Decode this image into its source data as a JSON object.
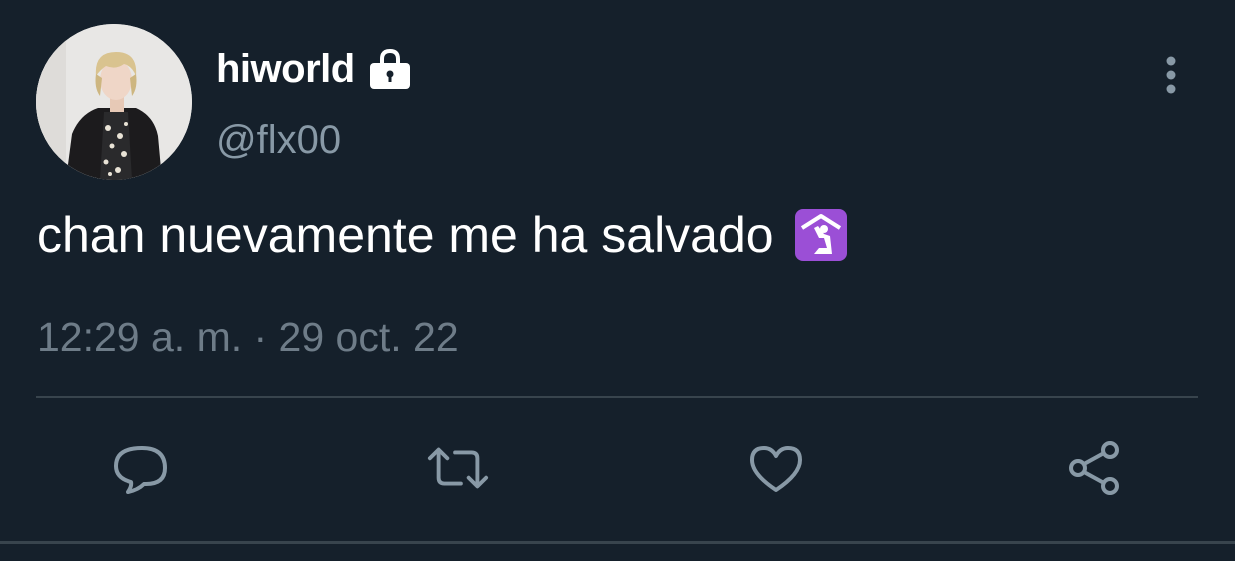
{
  "user": {
    "display_name": "hiworld",
    "handle": "@flx00",
    "protected_icon": "lock-icon",
    "avatar": "profile-photo"
  },
  "tweet": {
    "text": "chan nuevamente me ha salvado",
    "emoji": "place-of-worship-emoji",
    "timestamp": "12:29 a. m. · 29 oct. 22"
  },
  "actions": [
    {
      "name": "reply",
      "icon": "speech-bubble-icon"
    },
    {
      "name": "retweet",
      "icon": "retweet-icon"
    },
    {
      "name": "like",
      "icon": "heart-icon"
    },
    {
      "name": "share",
      "icon": "share-icon"
    }
  ],
  "menu": {
    "icon": "more-vertical-icon"
  },
  "colors": {
    "background": "#15202b",
    "primary_text": "#ffffff",
    "secondary_text": "#8899a6",
    "icon": "#8899a6",
    "divider": "#38444d",
    "emoji_purple": "#9b4fd6"
  }
}
